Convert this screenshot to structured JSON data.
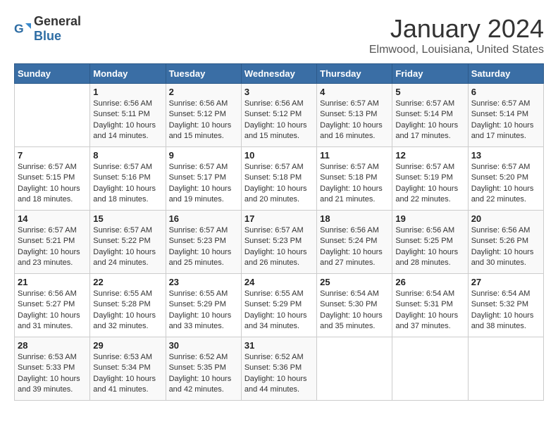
{
  "header": {
    "logo_general": "General",
    "logo_blue": "Blue",
    "title": "January 2024",
    "subtitle": "Elmwood, Louisiana, United States"
  },
  "days_of_week": [
    "Sunday",
    "Monday",
    "Tuesday",
    "Wednesday",
    "Thursday",
    "Friday",
    "Saturday"
  ],
  "weeks": [
    [
      {
        "day": "",
        "info": ""
      },
      {
        "day": "1",
        "info": "Sunrise: 6:56 AM\nSunset: 5:11 PM\nDaylight: 10 hours\nand 14 minutes."
      },
      {
        "day": "2",
        "info": "Sunrise: 6:56 AM\nSunset: 5:12 PM\nDaylight: 10 hours\nand 15 minutes."
      },
      {
        "day": "3",
        "info": "Sunrise: 6:56 AM\nSunset: 5:12 PM\nDaylight: 10 hours\nand 15 minutes."
      },
      {
        "day": "4",
        "info": "Sunrise: 6:57 AM\nSunset: 5:13 PM\nDaylight: 10 hours\nand 16 minutes."
      },
      {
        "day": "5",
        "info": "Sunrise: 6:57 AM\nSunset: 5:14 PM\nDaylight: 10 hours\nand 17 minutes."
      },
      {
        "day": "6",
        "info": "Sunrise: 6:57 AM\nSunset: 5:14 PM\nDaylight: 10 hours\nand 17 minutes."
      }
    ],
    [
      {
        "day": "7",
        "info": "Sunrise: 6:57 AM\nSunset: 5:15 PM\nDaylight: 10 hours\nand 18 minutes."
      },
      {
        "day": "8",
        "info": "Sunrise: 6:57 AM\nSunset: 5:16 PM\nDaylight: 10 hours\nand 18 minutes."
      },
      {
        "day": "9",
        "info": "Sunrise: 6:57 AM\nSunset: 5:17 PM\nDaylight: 10 hours\nand 19 minutes."
      },
      {
        "day": "10",
        "info": "Sunrise: 6:57 AM\nSunset: 5:18 PM\nDaylight: 10 hours\nand 20 minutes."
      },
      {
        "day": "11",
        "info": "Sunrise: 6:57 AM\nSunset: 5:18 PM\nDaylight: 10 hours\nand 21 minutes."
      },
      {
        "day": "12",
        "info": "Sunrise: 6:57 AM\nSunset: 5:19 PM\nDaylight: 10 hours\nand 22 minutes."
      },
      {
        "day": "13",
        "info": "Sunrise: 6:57 AM\nSunset: 5:20 PM\nDaylight: 10 hours\nand 22 minutes."
      }
    ],
    [
      {
        "day": "14",
        "info": "Sunrise: 6:57 AM\nSunset: 5:21 PM\nDaylight: 10 hours\nand 23 minutes."
      },
      {
        "day": "15",
        "info": "Sunrise: 6:57 AM\nSunset: 5:22 PM\nDaylight: 10 hours\nand 24 minutes."
      },
      {
        "day": "16",
        "info": "Sunrise: 6:57 AM\nSunset: 5:23 PM\nDaylight: 10 hours\nand 25 minutes."
      },
      {
        "day": "17",
        "info": "Sunrise: 6:57 AM\nSunset: 5:23 PM\nDaylight: 10 hours\nand 26 minutes."
      },
      {
        "day": "18",
        "info": "Sunrise: 6:56 AM\nSunset: 5:24 PM\nDaylight: 10 hours\nand 27 minutes."
      },
      {
        "day": "19",
        "info": "Sunrise: 6:56 AM\nSunset: 5:25 PM\nDaylight: 10 hours\nand 28 minutes."
      },
      {
        "day": "20",
        "info": "Sunrise: 6:56 AM\nSunset: 5:26 PM\nDaylight: 10 hours\nand 30 minutes."
      }
    ],
    [
      {
        "day": "21",
        "info": "Sunrise: 6:56 AM\nSunset: 5:27 PM\nDaylight: 10 hours\nand 31 minutes."
      },
      {
        "day": "22",
        "info": "Sunrise: 6:55 AM\nSunset: 5:28 PM\nDaylight: 10 hours\nand 32 minutes."
      },
      {
        "day": "23",
        "info": "Sunrise: 6:55 AM\nSunset: 5:29 PM\nDaylight: 10 hours\nand 33 minutes."
      },
      {
        "day": "24",
        "info": "Sunrise: 6:55 AM\nSunset: 5:29 PM\nDaylight: 10 hours\nand 34 minutes."
      },
      {
        "day": "25",
        "info": "Sunrise: 6:54 AM\nSunset: 5:30 PM\nDaylight: 10 hours\nand 35 minutes."
      },
      {
        "day": "26",
        "info": "Sunrise: 6:54 AM\nSunset: 5:31 PM\nDaylight: 10 hours\nand 37 minutes."
      },
      {
        "day": "27",
        "info": "Sunrise: 6:54 AM\nSunset: 5:32 PM\nDaylight: 10 hours\nand 38 minutes."
      }
    ],
    [
      {
        "day": "28",
        "info": "Sunrise: 6:53 AM\nSunset: 5:33 PM\nDaylight: 10 hours\nand 39 minutes."
      },
      {
        "day": "29",
        "info": "Sunrise: 6:53 AM\nSunset: 5:34 PM\nDaylight: 10 hours\nand 41 minutes."
      },
      {
        "day": "30",
        "info": "Sunrise: 6:52 AM\nSunset: 5:35 PM\nDaylight: 10 hours\nand 42 minutes."
      },
      {
        "day": "31",
        "info": "Sunrise: 6:52 AM\nSunset: 5:36 PM\nDaylight: 10 hours\nand 44 minutes."
      },
      {
        "day": "",
        "info": ""
      },
      {
        "day": "",
        "info": ""
      },
      {
        "day": "",
        "info": ""
      }
    ]
  ]
}
